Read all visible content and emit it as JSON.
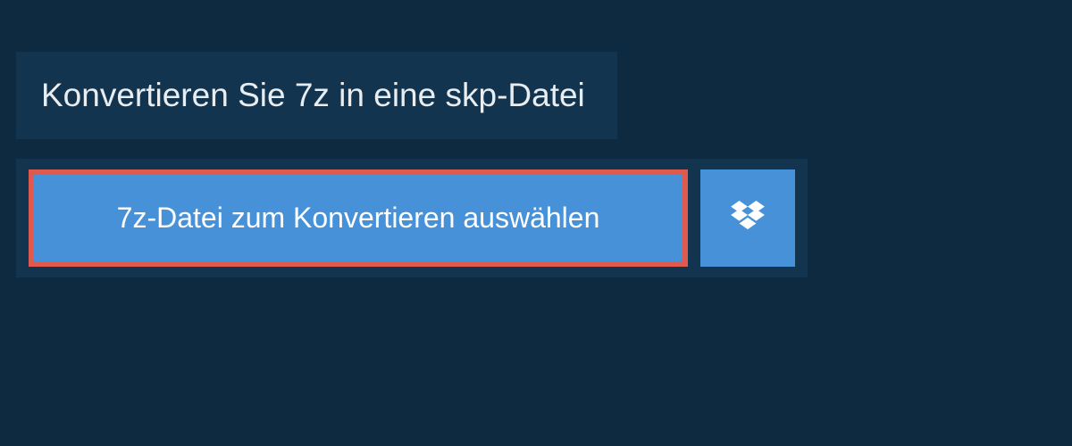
{
  "header": {
    "title": "Konvertieren Sie 7z in eine skp-Datei"
  },
  "upload": {
    "select_button_label": "7z-Datei zum Konvertieren auswählen",
    "dropbox_icon_name": "dropbox-icon"
  },
  "colors": {
    "background": "#0e2a40",
    "panel": "#13344e",
    "button_primary": "#4691d8",
    "highlight_border": "#de5a4e",
    "text_light": "#e8edf1"
  }
}
